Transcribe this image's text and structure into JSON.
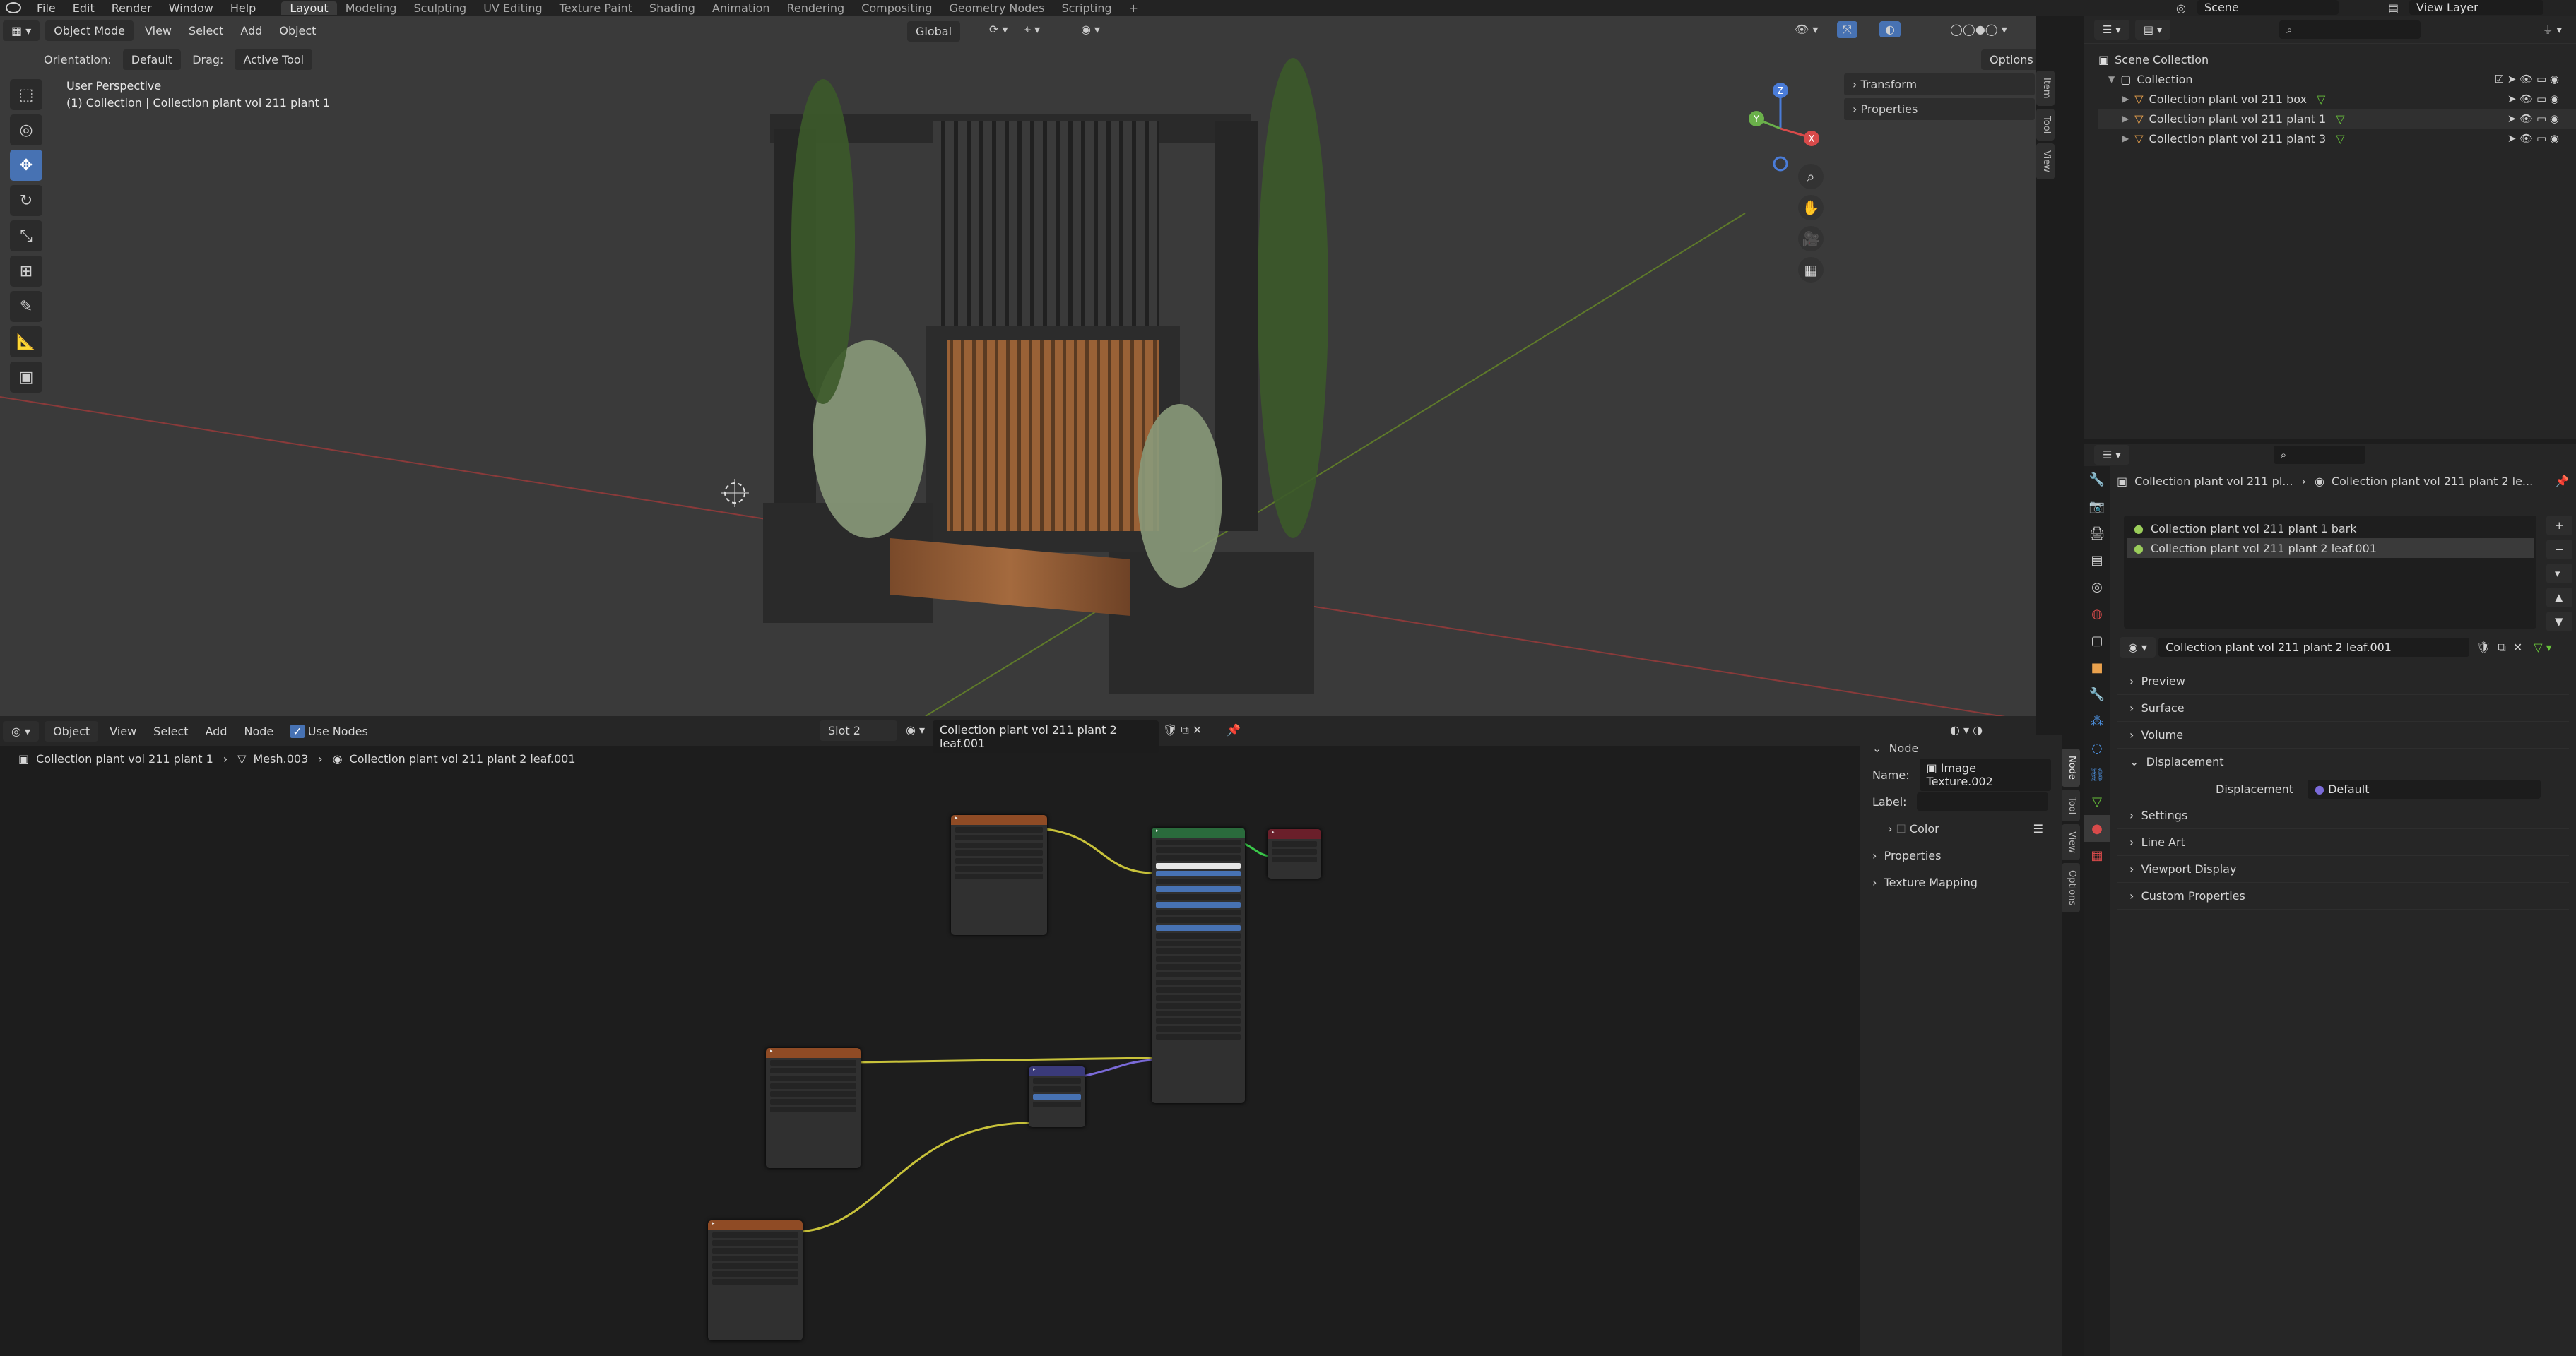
{
  "menu": {
    "items": [
      "File",
      "Edit",
      "Render",
      "Window",
      "Help"
    ],
    "workspaces": [
      "Layout",
      "Modeling",
      "Sculpting",
      "UV Editing",
      "Texture Paint",
      "Shading",
      "Animation",
      "Rendering",
      "Compositing",
      "Geometry Nodes",
      "Scripting"
    ],
    "active_workspace": "Layout",
    "scene": "Scene",
    "view_layer": "View Layer"
  },
  "viewport": {
    "mode": "Object Mode",
    "menus": [
      "View",
      "Select",
      "Add",
      "Object"
    ],
    "transform": "Global",
    "orientation_label": "Orientation:",
    "orientation_value": "Default",
    "drag_label": "Drag:",
    "drag_value": "Active Tool",
    "options": "Options",
    "perspective": "User Perspective",
    "collection_info": "(1) Collection | Collection plant vol 211 plant 1",
    "npanel": [
      "Transform",
      "Properties"
    ],
    "npanel_tabs": [
      "Item",
      "Tool",
      "View"
    ],
    "gizmo_axes": {
      "z": "Z",
      "y": "Y",
      "x": "X"
    }
  },
  "outliner": {
    "scene_collection": "Scene Collection",
    "collection": "Collection",
    "objects": [
      "Collection plant vol 211 box",
      "Collection plant vol 211 plant 1",
      "Collection plant vol 211 plant 3"
    ]
  },
  "properties": {
    "breadcrumb_left": "Collection plant vol 211 pl...",
    "breadcrumb_right": "Collection plant vol 211  plant 2  le...",
    "materials": [
      "Collection plant vol 211 plant 1  bark",
      "Collection plant vol 211  plant 2  leaf.001"
    ],
    "material_name": "Collection plant vol 211  plant 2  leaf.001",
    "sections": [
      "Preview",
      "Surface",
      "Volume",
      "Displacement",
      "Settings",
      "Line Art",
      "Viewport Display",
      "Custom Properties"
    ],
    "displacement_label": "Displacement",
    "displacement_value": "Default"
  },
  "node_editor": {
    "mode": "Object",
    "menus": [
      "View",
      "Select",
      "Add",
      "Node"
    ],
    "use_nodes": "Use Nodes",
    "slot": "Slot 2",
    "material": "Collection plant vol 211  plant 2  leaf.001",
    "breadcrumb": [
      "Collection plant vol 211 plant 1",
      "Mesh.003",
      "Collection plant vol 211  plant 2  leaf.001"
    ],
    "sidebar": {
      "section": "Node",
      "name_label": "Name:",
      "name_value": "Image Texture.002",
      "label_label": "Label:",
      "color": "Color",
      "properties": "Properties",
      "texture_mapping": "Texture Mapping",
      "tabs": [
        "Node",
        "Tool",
        "View",
        "Options"
      ]
    }
  },
  "colors": {
    "accent": "#4772b3",
    "node_texture": "#8f4b25",
    "node_shader": "#2a6b3c",
    "node_output": "#6a1f2a",
    "node_vector": "#3a3a7a",
    "link_yellow": "#c8c23a",
    "link_purple": "#7a6ad8"
  }
}
